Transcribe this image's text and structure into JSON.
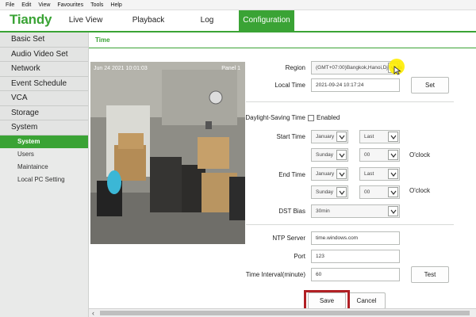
{
  "menubar": [
    "File",
    "Edit",
    "View",
    "Favourites",
    "Tools",
    "Help"
  ],
  "brand": {
    "logo_text": "Tiandy",
    "color": "#3aa335"
  },
  "nav": {
    "live_view": "Live View",
    "playback": "Playback",
    "log": "Log",
    "configuration": "Configuration"
  },
  "sidebar": {
    "groups": [
      "Basic Set",
      "Audio Video Set",
      "Network",
      "Event Schedule",
      "VCA",
      "Storage",
      "System"
    ],
    "system_items": [
      "System",
      "Users",
      "Maintaince",
      "Local PC Setting"
    ]
  },
  "content": {
    "subtab": "Time",
    "camera": {
      "timestamp": "Jun 24 2021 10:01:03",
      "label": "Panel 1"
    },
    "region": {
      "label": "Region",
      "value": "(GMT+07:00)Bangkok,Hanoi,Djakarta"
    },
    "local_time": {
      "label": "Local Time",
      "value": "2021-09-24 10:17:24",
      "set_button": "Set"
    },
    "dst": {
      "label": "Daylight-Saving Time",
      "enabled_label": "Enabled",
      "enabled": false,
      "start_time_label": "Start Time",
      "start": {
        "month": "January",
        "week": "Last",
        "day": "Sunday",
        "hour": "00"
      },
      "end_time_label": "End Time",
      "end": {
        "month": "January",
        "week": "Last",
        "day": "Sunday",
        "hour": "00"
      },
      "oclock": "O'clock",
      "bias_label": "DST Bias",
      "bias_value": "30min"
    },
    "ntp": {
      "server_label": "NTP Server",
      "server_value": "time.windows.com",
      "port_label": "Port",
      "port_value": "123",
      "interval_label": "Time Interval(minute)",
      "interval_value": "60",
      "test_button": "Test"
    },
    "save_button": "Save",
    "cancel_button": "Cancel"
  },
  "colors": {
    "accent": "#3aa335",
    "highlight_box": "#b01f24",
    "cursor": "#ffed00"
  }
}
